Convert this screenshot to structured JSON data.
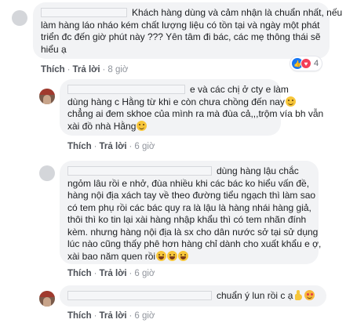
{
  "comments": [
    {
      "lines": [
        "Khách hàng dùng và cảm nhận là chuẩn nhất, nếu",
        "làm hàng láo nháo kém chất lượng liệu có tồn tại và ngày một phát",
        "triển đc đến giờ phút này ??? Yên tâm đi bác, các mẹ thông thái sẽ",
        "hiểu ạ"
      ],
      "like": "Thích",
      "reply": "Trả lời",
      "time": "8 giờ",
      "reactions": {
        "like_icon": "like-reaction-icon",
        "love_icon": "love-reaction-icon",
        "count": "4"
      }
    },
    {
      "lines": [
        "e và các chị ở cty e làm",
        "dùng hàng c Hằng từ khi e còn chưa chồng đến nay",
        "chẳng ai đem skhoe của mình ra mà đùa cả,,,trộm vía bh vẫn",
        "xài đồ nhà Hằng"
      ],
      "like": "Thích",
      "reply": "Trả lời",
      "time": "6 giờ"
    },
    {
      "lines": [
        "dùng hàng lậu chắc",
        "ngỏm lâu rồi e nhở, đùa nhiều khi các bác ko hiểu vấn đề,",
        "hàng nội địa xách tay về theo đường tiểu ngạch thì làm sao",
        "có tem phụ rồi các bác quy ra là lậu là hàng nhái hàng giả,",
        "thôi thì ko tin lại xài hàng nhập khẩu thì có tem nhãn đính",
        "kèm. nhưng hàng nội địa là sx cho dân nước sở tại sử dụng",
        "lúc nào cũng thấy phê hơn hàng chỉ dành cho xuất khẩu e ợ,",
        "xài bao năm quen rồi"
      ],
      "like": "Thích",
      "reply": "Trả lời",
      "time": "6 giờ"
    },
    {
      "lines": [
        "chuẩn ý lun rồi c ạ"
      ],
      "like": "Thích",
      "reply": "Trả lời",
      "time": "6 giờ"
    }
  ],
  "colors": {
    "bubble": "#f2f3f5",
    "link": "#4b4f56",
    "time": "#90949c",
    "like_blue": "#1877f2",
    "love_red": "#f33e58"
  }
}
